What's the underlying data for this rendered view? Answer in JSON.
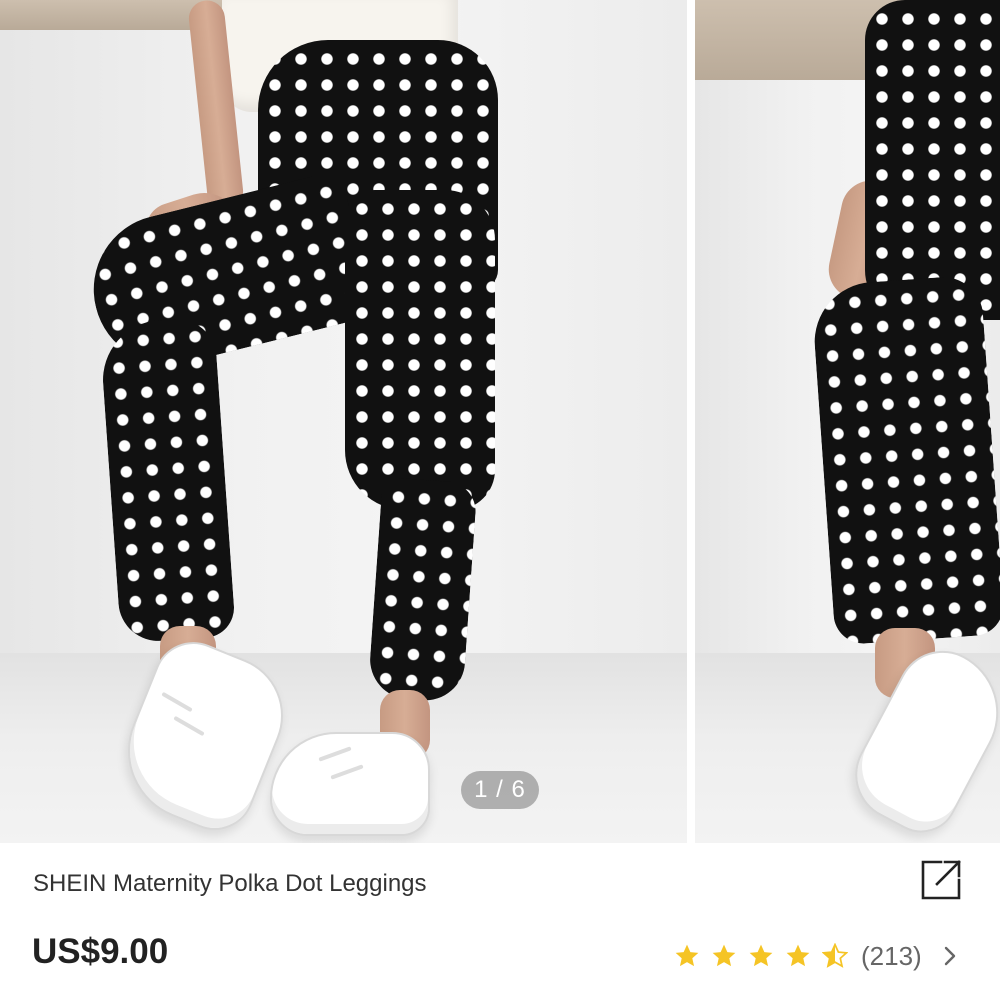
{
  "gallery": {
    "counter": "1 / 6",
    "current_index": 1,
    "total_images": 6
  },
  "product": {
    "title": "SHEIN Maternity Polka Dot Leggings",
    "price": "US$9.00",
    "rating": 4.5,
    "review_count": "(213)"
  },
  "icons": {
    "share": "share-external-icon",
    "star": "star-icon",
    "reviews_arrow": "chevron-right-icon"
  },
  "colors": {
    "star": "#f5c425",
    "price": "#222222",
    "counter_bg": "#787878"
  }
}
